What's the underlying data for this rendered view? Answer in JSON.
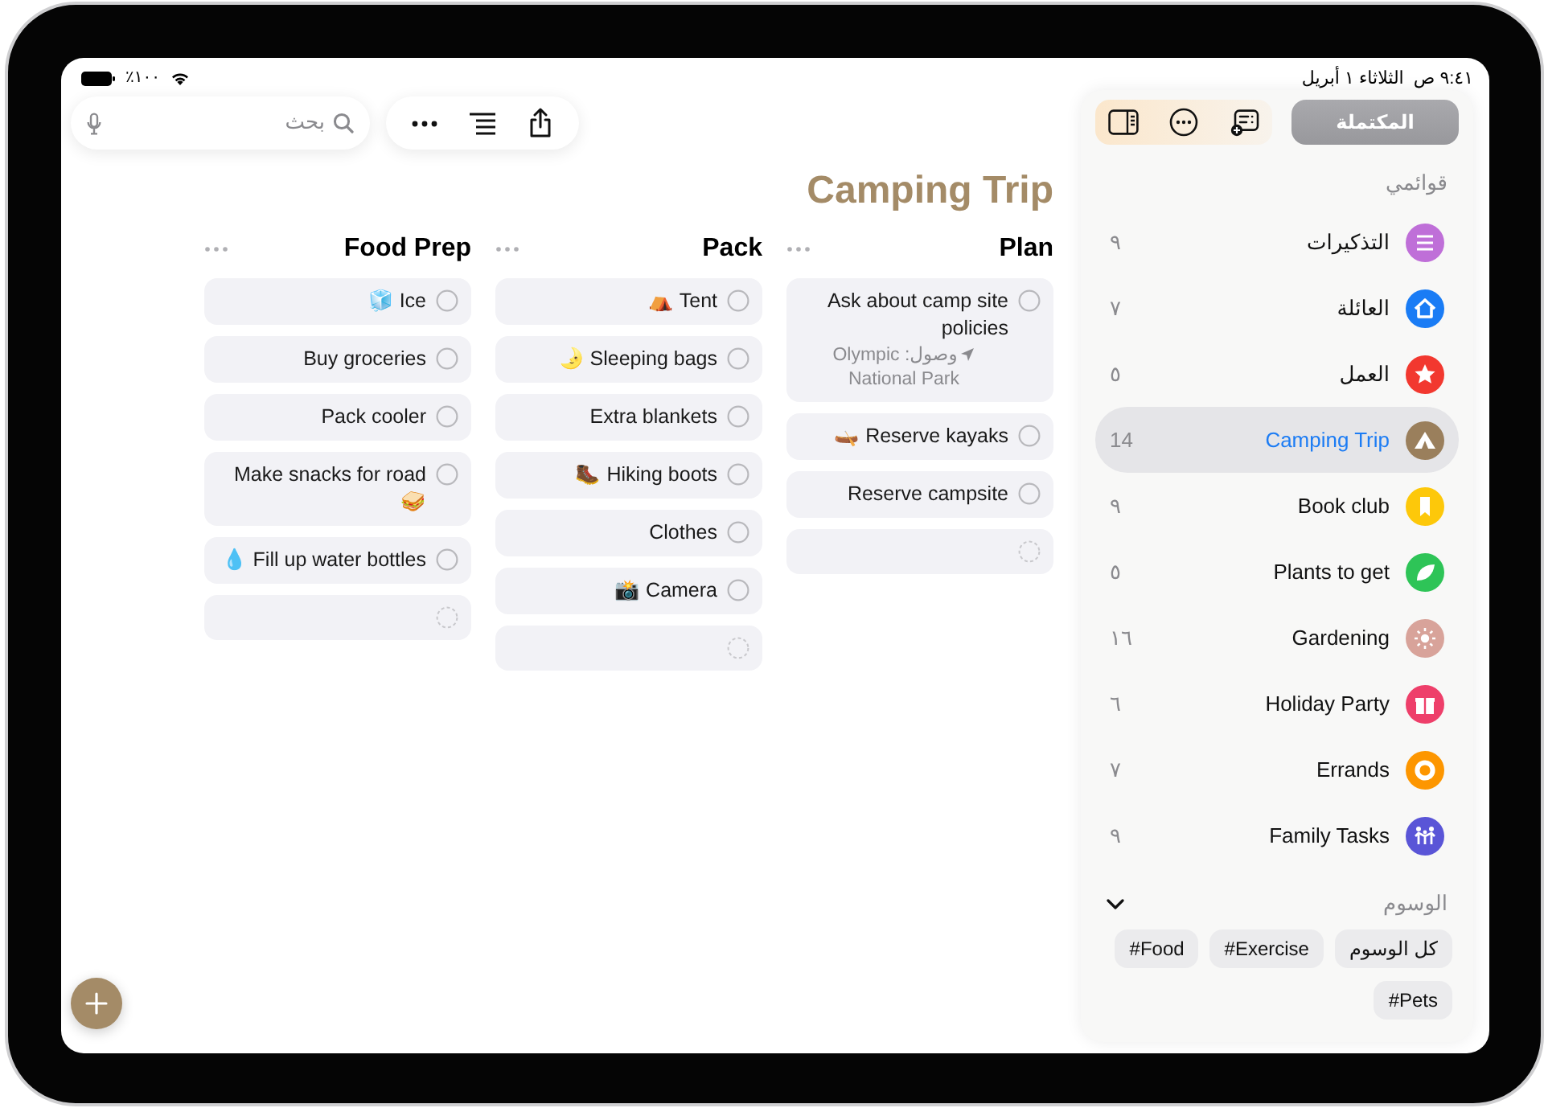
{
  "status_bar": {
    "time": "٩:٤١ ص",
    "date": "الثلاثاء ١ أبريل",
    "battery": "٪١٠٠"
  },
  "toolbar": {
    "search": {
      "placeholder": "بحث"
    }
  },
  "list_title": "Camping Trip",
  "columns": [
    {
      "title": "Plan",
      "items": [
        {
          "kind": "task",
          "text": "Ask about camp site policies",
          "note": "وصول: Olympic National Park"
        },
        {
          "kind": "task",
          "text": "🛶 Reserve kayaks"
        },
        {
          "kind": "task",
          "text": "Reserve campsite"
        },
        {
          "kind": "new"
        }
      ]
    },
    {
      "title": "Pack",
      "items": [
        {
          "kind": "task",
          "text": "⛺ Tent"
        },
        {
          "kind": "task",
          "text": "🌛 Sleeping bags"
        },
        {
          "kind": "task",
          "text": "Extra blankets"
        },
        {
          "kind": "task",
          "text": "🥾 Hiking boots"
        },
        {
          "kind": "task",
          "text": "Clothes"
        },
        {
          "kind": "task",
          "text": "📸 Camera"
        },
        {
          "kind": "new"
        }
      ]
    },
    {
      "title": "Food Prep",
      "items": [
        {
          "kind": "task",
          "text": "🧊 Ice"
        },
        {
          "kind": "task",
          "text": "Buy groceries"
        },
        {
          "kind": "task",
          "text": "Pack cooler"
        },
        {
          "kind": "task",
          "text": "Make snacks for road 🥪"
        },
        {
          "kind": "task",
          "text": "💧 Fill up water bottles"
        },
        {
          "kind": "new"
        }
      ]
    }
  ],
  "sidebar": {
    "completed_button": "المكتملة",
    "section_title": "قوائمي",
    "lists": [
      {
        "name": "التذكيرات",
        "count": "٩",
        "color": "#bf6fd8",
        "selected": false
      },
      {
        "name": "العائلة",
        "count": "٧",
        "color": "#1a7cf5",
        "selected": false
      },
      {
        "name": "العمل",
        "count": "٥",
        "color": "#f2382f",
        "selected": false
      },
      {
        "name": "Camping Trip",
        "count": "14",
        "color": "#9a7f5c",
        "selected": true
      },
      {
        "name": "Book club",
        "count": "٩",
        "color": "#fdc80a",
        "selected": false
      },
      {
        "name": "Plants to get",
        "count": "٥",
        "color": "#2ec457",
        "selected": false
      },
      {
        "name": "Gardening",
        "count": "١٦",
        "color": "#d8a39a",
        "selected": false
      },
      {
        "name": "Holiday Party",
        "count": "٦",
        "color": "#ee3f6a",
        "selected": false
      },
      {
        "name": "Errands",
        "count": "٧",
        "color": "#fd9600",
        "selected": false
      },
      {
        "name": "Family Tasks",
        "count": "٩",
        "color": "#5a55d7",
        "selected": false
      }
    ],
    "tags_title": "الوسوم",
    "tags_expanded": true,
    "tags": [
      "كل الوسوم",
      "#Exercise",
      "#Food",
      "#Pets"
    ]
  }
}
